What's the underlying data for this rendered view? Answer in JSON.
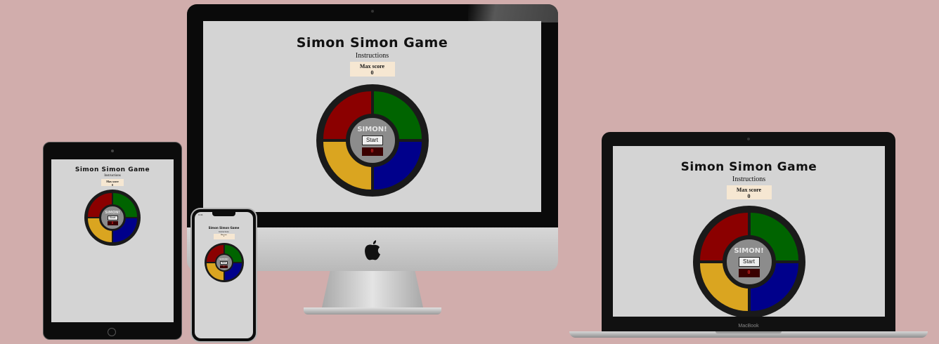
{
  "game": {
    "title": "Simon Simon Game",
    "instructions": "Instructions",
    "max_score_label": "Max score",
    "max_score_value": "0",
    "center_label": "SIMON!",
    "start_label": "Start",
    "score_value": "0"
  },
  "laptop": {
    "brand": "MacBook"
  },
  "phone": {
    "status_time": "9:41"
  },
  "colors": {
    "background": "#d1adac",
    "screen": "#d4d4d4",
    "red": "#8b0000",
    "green": "#006400",
    "yellow": "#daa520",
    "blue": "#00008b",
    "max_score_box": "#f6e7d2"
  }
}
